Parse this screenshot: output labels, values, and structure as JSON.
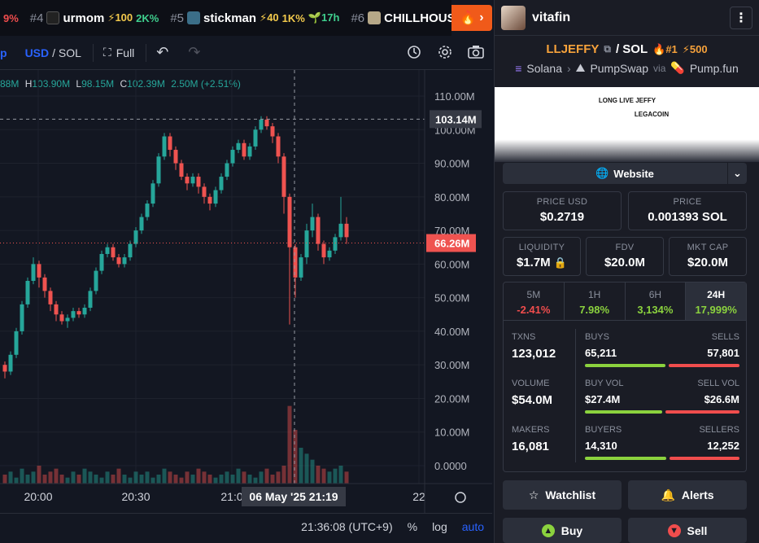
{
  "ticker": [
    {
      "rank": "",
      "name": "",
      "chg_prefix": "9%"
    },
    {
      "rank": "#4",
      "name": "urmom",
      "boost": "⚡100",
      "change": "2K%"
    },
    {
      "rank": "#5",
      "name": "stickman",
      "boost": "⚡40",
      "change": "1K%",
      "age": "17h"
    },
    {
      "rank": "#6",
      "name": "CHILLHOUS",
      "boost": "",
      "change": ""
    }
  ],
  "hot_label": "›",
  "chart_toolbar": {
    "symbol_partial": "p",
    "currency": "USD",
    "currency_alt": "/ SOL",
    "full_label": "Full"
  },
  "ohlc": {
    "o_tail": "88M",
    "h_label": "H",
    "h_val": "103.90M",
    "l_label": "L",
    "l_val": "98.15M",
    "c_label": "C",
    "c_val": "102.39M",
    "vol": "2.50M",
    "chg": "(+2.51%)"
  },
  "chart_data": {
    "type": "candlestick",
    "y_ticks": [
      "110.00M",
      "100.00M",
      "90.00M",
      "80.00M",
      "70.00M",
      "60.00M",
      "50.00M",
      "40.00M",
      "30.00M",
      "20.00M",
      "10.00M",
      "0.0000"
    ],
    "y_min": 0,
    "y_max": 110,
    "x_ticks": [
      "20:00",
      "20:30",
      "21:0",
      "22"
    ],
    "crosshair_price": "103.14M",
    "crosshair_price_value": 103.14,
    "crosshair_time": "06 May '25   21:19",
    "last_price": "66.26M",
    "last_price_value": 66.26,
    "candles": [
      [
        30,
        28,
        31,
        26
      ],
      [
        28,
        33,
        34,
        27
      ],
      [
        33,
        40,
        41,
        32
      ],
      [
        40,
        48,
        49,
        39
      ],
      [
        48,
        55,
        56,
        47
      ],
      [
        55,
        60,
        62,
        54
      ],
      [
        60,
        56,
        61,
        53
      ],
      [
        56,
        52,
        57,
        50
      ],
      [
        52,
        48,
        53,
        46
      ],
      [
        48,
        45,
        49,
        43
      ],
      [
        45,
        43,
        46,
        42
      ],
      [
        43,
        44,
        45,
        41
      ],
      [
        44,
        46,
        47,
        43
      ],
      [
        46,
        45,
        47,
        44
      ],
      [
        45,
        47,
        48,
        44
      ],
      [
        47,
        52,
        53,
        46
      ],
      [
        52,
        58,
        59,
        51
      ],
      [
        58,
        63,
        64,
        57
      ],
      [
        63,
        65,
        66,
        62
      ],
      [
        65,
        62,
        66,
        61
      ],
      [
        62,
        60,
        63,
        59
      ],
      [
        60,
        62,
        63,
        59
      ],
      [
        62,
        66,
        67,
        61
      ],
      [
        66,
        70,
        71,
        65
      ],
      [
        70,
        74,
        75,
        69
      ],
      [
        74,
        78,
        79,
        73
      ],
      [
        78,
        84,
        85,
        77
      ],
      [
        84,
        92,
        93,
        83
      ],
      [
        92,
        98,
        99,
        91
      ],
      [
        98,
        94,
        99,
        92
      ],
      [
        94,
        90,
        95,
        88
      ],
      [
        90,
        86,
        91,
        85
      ],
      [
        86,
        84,
        87,
        82
      ],
      [
        84,
        86,
        87,
        83
      ],
      [
        86,
        83,
        87,
        81
      ],
      [
        83,
        80,
        84,
        78
      ],
      [
        80,
        78,
        81,
        76
      ],
      [
        78,
        82,
        83,
        77
      ],
      [
        82,
        86,
        87,
        81
      ],
      [
        86,
        90,
        91,
        85
      ],
      [
        90,
        94,
        95,
        89
      ],
      [
        94,
        96,
        97,
        93
      ],
      [
        96,
        92,
        97,
        91
      ],
      [
        92,
        95,
        96,
        91
      ],
      [
        95,
        100,
        101,
        94
      ],
      [
        100,
        103,
        104,
        99
      ],
      [
        103,
        101,
        104,
        100
      ],
      [
        101,
        98,
        102,
        96
      ],
      [
        98,
        92,
        99,
        90
      ],
      [
        92,
        80,
        93,
        75
      ],
      [
        80,
        65,
        81,
        42
      ],
      [
        65,
        56,
        66,
        50
      ],
      [
        56,
        62,
        63,
        55
      ],
      [
        62,
        70,
        72,
        60
      ],
      [
        70,
        74,
        78,
        68
      ],
      [
        74,
        66,
        75,
        64
      ],
      [
        66,
        62,
        67,
        60
      ],
      [
        62,
        64,
        65,
        61
      ],
      [
        64,
        68,
        69,
        63
      ],
      [
        68,
        72,
        80,
        67
      ],
      [
        72,
        68,
        74,
        66
      ]
    ],
    "volumes": [
      3,
      4,
      2,
      5,
      3,
      4,
      6,
      3,
      4,
      5,
      3,
      2,
      4,
      3,
      5,
      4,
      3,
      2,
      4,
      3,
      5,
      3,
      2,
      4,
      3,
      4,
      2,
      3,
      5,
      4,
      3,
      2,
      4,
      3,
      5,
      4,
      3,
      2,
      3,
      4,
      3,
      5,
      4,
      3,
      2,
      4,
      5,
      3,
      4,
      6,
      26,
      18,
      12,
      10,
      8,
      6,
      5,
      4,
      5,
      6,
      4
    ]
  },
  "time_footer": {
    "time": "21:36:08 (UTC+9)",
    "pct": "%",
    "log": "log",
    "auto": "auto"
  },
  "user": {
    "name": "vitafin"
  },
  "token": {
    "symbol": "LLJEFFY",
    "quote": "/ SOL",
    "rank": "🔥#1",
    "boost": "⚡500",
    "chain": "Solana",
    "dex": "PumpSwap",
    "via": "via",
    "launchpad": "Pump.fun",
    "banner_line1": "LONG  LIVE  JEFFY",
    "banner_line2": "LEGACOIN",
    "website": "Website"
  },
  "prices": {
    "price_usd_label": "PRICE USD",
    "price_usd": "$0.2719",
    "price_label": "PRICE",
    "price": "0.001393 SOL"
  },
  "metrics": {
    "liq_label": "LIQUIDITY",
    "liq": "$1.7M",
    "fdv_label": "FDV",
    "fdv": "$20.0M",
    "mcap_label": "MKT CAP",
    "mcap": "$20.0M"
  },
  "timeframes": [
    {
      "label": "5M",
      "pct": "-2.41%",
      "dir": "down"
    },
    {
      "label": "1H",
      "pct": "7.98%",
      "dir": "up"
    },
    {
      "label": "6H",
      "pct": "3,134%",
      "dir": "up"
    },
    {
      "label": "24H",
      "pct": "17,999%",
      "dir": "up"
    }
  ],
  "stats": {
    "txns_label": "TXNS",
    "txns": "123,012",
    "buys_label": "BUYS",
    "buys": "65,211",
    "sells_label": "SELLS",
    "sells": "57,801",
    "buys_ratio": 0.53,
    "volume_label": "VOLUME",
    "volume": "$54.0M",
    "buyvol_label": "BUY VOL",
    "buyvol": "$27.4M",
    "sellvol_label": "SELL VOL",
    "sellvol": "$26.6M",
    "buyvol_ratio": 0.51,
    "makers_label": "MAKERS",
    "makers": "16,081",
    "buyers_label": "BUYERS",
    "buyers": "14,310",
    "sellers_label": "SELLERS",
    "sellers": "12,252",
    "buyers_ratio": 0.54
  },
  "actions": {
    "watchlist": "Watchlist",
    "alerts": "Alerts",
    "buy": "Buy",
    "sell": "Sell"
  },
  "colors": {
    "up": "#26a69a",
    "down": "#ef5350",
    "accent": "#2962ff",
    "orange": "#f05a1a"
  }
}
